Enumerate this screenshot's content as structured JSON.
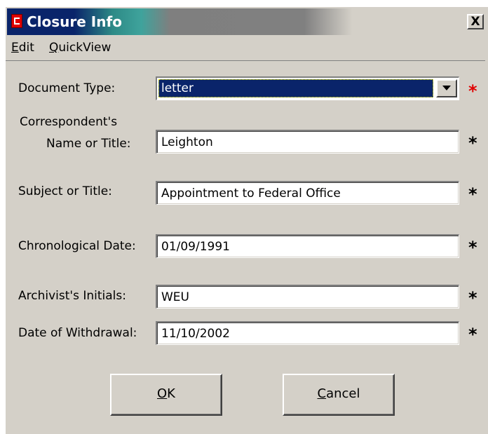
{
  "window": {
    "title": "Closure Info",
    "close_glyph": "X"
  },
  "menu": {
    "items": [
      {
        "label_first": "E",
        "label_rest": "dit"
      },
      {
        "label_first": "Q",
        "label_rest": "uickView"
      }
    ]
  },
  "form": {
    "document_type": {
      "label": "Document Type:",
      "value": "letter",
      "required": "*"
    },
    "correspondent": {
      "label_line1": "Correspondent's",
      "label_line2": "Name or Title:",
      "value": "Leighton",
      "required": "*"
    },
    "subject": {
      "label": "Subject or Title:",
      "value": "Appointment to Federal Office",
      "required": "*"
    },
    "chron_date": {
      "label": "Chronological Date:",
      "value": "01/09/1991",
      "required": "*"
    },
    "archivist": {
      "label": "Archivist's Initials:",
      "value": "WEU",
      "required": "*"
    },
    "withdrawal_date": {
      "label": "Date of Withdrawal:",
      "value": "11/10/2002",
      "required": "*"
    }
  },
  "buttons": {
    "ok": {
      "first": "O",
      "rest": "K"
    },
    "cancel": {
      "first": "C",
      "rest": "ancel"
    }
  },
  "colors": {
    "titlebar_active": "#0a246a",
    "required_marker_highlight": "#e00000",
    "dialog_face": "#d4d0c8"
  }
}
